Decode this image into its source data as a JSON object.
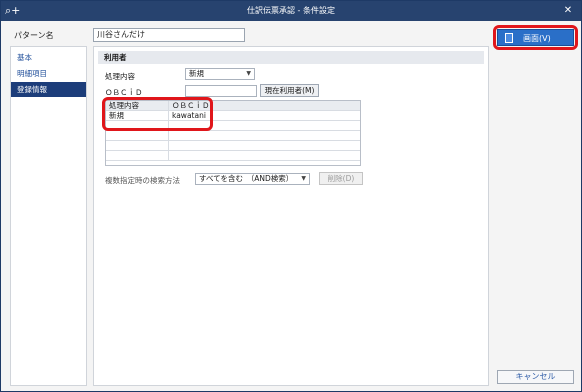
{
  "window": {
    "title": "仕訳伝票承認 - 条件設定",
    "close_glyph": "✕",
    "app_icon": "search-plus-icon"
  },
  "pattern": {
    "label": "パターン名",
    "value": "川谷さんだけ"
  },
  "nav": {
    "items": [
      {
        "label": "基本",
        "active": false
      },
      {
        "label": "明細項目",
        "active": false
      },
      {
        "label": "登録情報",
        "active": true
      }
    ]
  },
  "user_section": {
    "header": "利用者",
    "process_label": "処理内容",
    "process_value": "新規",
    "obcid_label": "ＯＢＣｉＤ",
    "obcid_value": "",
    "current_user_button": "現在利用者(M)",
    "grid": {
      "columns": [
        "処理内容",
        "ＯＢＣｉＤ"
      ],
      "rows": [
        [
          "新規",
          "kawatani"
        ]
      ]
    },
    "multi_search_label": "複数指定時の検索方法",
    "multi_search_value": "すべてを含む　（AND検索）",
    "delete_button": "削除(D)"
  },
  "actions": {
    "display_button": "画面(V)",
    "cancel_button": "キャンセル"
  },
  "colors": {
    "titlebar": "#27436f",
    "accent": "#2a6fc8",
    "highlight": "#e0161b",
    "nav_active": "#1c3d7a"
  }
}
